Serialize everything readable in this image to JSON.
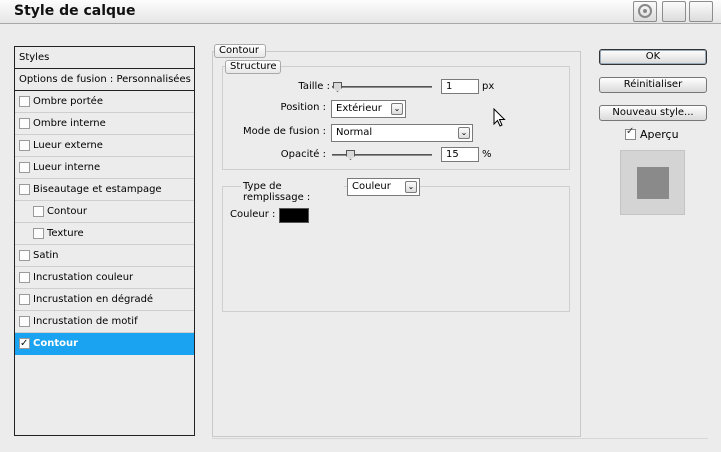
{
  "window": {
    "title": "Style de calque"
  },
  "titlebar": {
    "gear_icon": "gear-icon",
    "min_icon": "minimize-icon",
    "close_icon": "close-icon"
  },
  "styles_panel": {
    "header": "Styles",
    "blend_options": "Options de fusion : Personnalisées",
    "items": [
      {
        "label": "Ombre portée",
        "checked": false,
        "indent": false,
        "checkbox": true
      },
      {
        "label": "Ombre interne",
        "checked": false,
        "indent": false,
        "checkbox": true
      },
      {
        "label": "Lueur externe",
        "checked": false,
        "indent": false,
        "checkbox": true
      },
      {
        "label": "Lueur interne",
        "checked": false,
        "indent": false,
        "checkbox": true
      },
      {
        "label": "Biseautage et estampage",
        "checked": false,
        "indent": false,
        "checkbox": true
      },
      {
        "label": "Contour",
        "checked": false,
        "indent": true,
        "checkbox": true
      },
      {
        "label": "Texture",
        "checked": false,
        "indent": true,
        "checkbox": true
      },
      {
        "label": "Satin",
        "checked": false,
        "indent": false,
        "checkbox": true
      },
      {
        "label": "Incrustation couleur",
        "checked": false,
        "indent": false,
        "checkbox": true
      },
      {
        "label": "Incrustation en dégradé",
        "checked": false,
        "indent": false,
        "checkbox": true
      },
      {
        "label": "Incrustation de motif",
        "checked": false,
        "indent": false,
        "checkbox": true
      },
      {
        "label": "Contour",
        "checked": true,
        "indent": false,
        "checkbox": true,
        "selected": true
      }
    ]
  },
  "contour": {
    "section_title": "Contour",
    "structure_title": "Structure",
    "size_label": "Taille :",
    "size_value": "1",
    "size_unit": "px",
    "size_slider_level": 0.01,
    "position_label": "Position :",
    "position_value": "Extérieur",
    "blend_mode_label": "Mode de fusion :",
    "blend_mode_value": "Normal",
    "opacity_label": "Opacité :",
    "opacity_value": "15",
    "opacity_unit": "%",
    "opacity_slider_level": 0.15,
    "fill_type_label": "Type de remplissage :",
    "fill_type_value": "Couleur",
    "color_label": "Couleur :",
    "color_value": "#000000"
  },
  "buttons": {
    "ok": "OK",
    "reset": "Réinitialiser",
    "new_style": "Nouveau style...",
    "preview_label": "Aperçu",
    "preview_checked": true
  },
  "colors": {
    "selection": "#1aa3f0",
    "background": "#ececec"
  }
}
